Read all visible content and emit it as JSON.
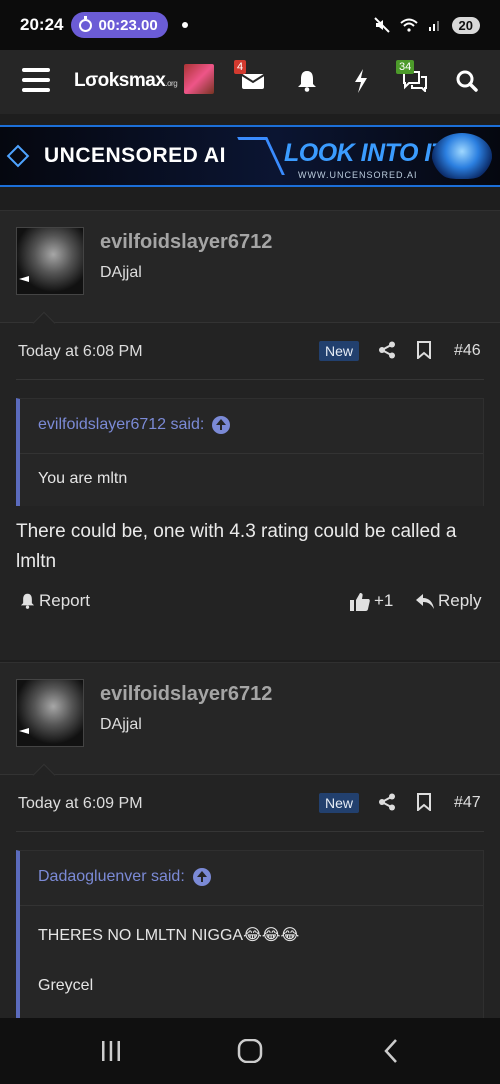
{
  "status_bar": {
    "time": "20:24",
    "timer": "00:23.00",
    "battery": "20"
  },
  "header": {
    "logo": "Lσoksmax",
    "logo_suffix": ".org",
    "alerts_badge": "4",
    "conversations_badge": "34",
    "icons": [
      "menu-icon",
      "avatar",
      "inbox-icon",
      "bell-icon",
      "bolt-icon",
      "chat-icon",
      "search-icon"
    ]
  },
  "banner": {
    "left_text": "UNCENSORED AI",
    "right_text": "LOOK INTO IT",
    "url": "WWW.UNCENSORED.AI"
  },
  "posts": [
    {
      "username": "evilfoidslayer6712",
      "user_title": "DAjjal",
      "date": "Today at 6:08 PM",
      "new_label": "New",
      "post_number": "#46",
      "quote": {
        "author": "evilfoidslayer6712 said:",
        "lines": [
          "You are mltn"
        ]
      },
      "text": "There could be, one with 4.3 rating could be called a lmltn",
      "report_label": "Report",
      "reactions": "+1",
      "reply_label": "Reply"
    },
    {
      "username": "evilfoidslayer6712",
      "user_title": "DAjjal",
      "date": "Today at 6:09 PM",
      "new_label": "New",
      "post_number": "#47",
      "quote": {
        "author": "Dadaogluenver said:",
        "lines": [
          "THERES NO LMLTN NIGGA😂😂😂",
          "Greycel"
        ]
      }
    }
  ],
  "colors": {
    "accent": "#7b8ad6",
    "new_badge": "#22406e",
    "background": "#1e1e1e"
  }
}
